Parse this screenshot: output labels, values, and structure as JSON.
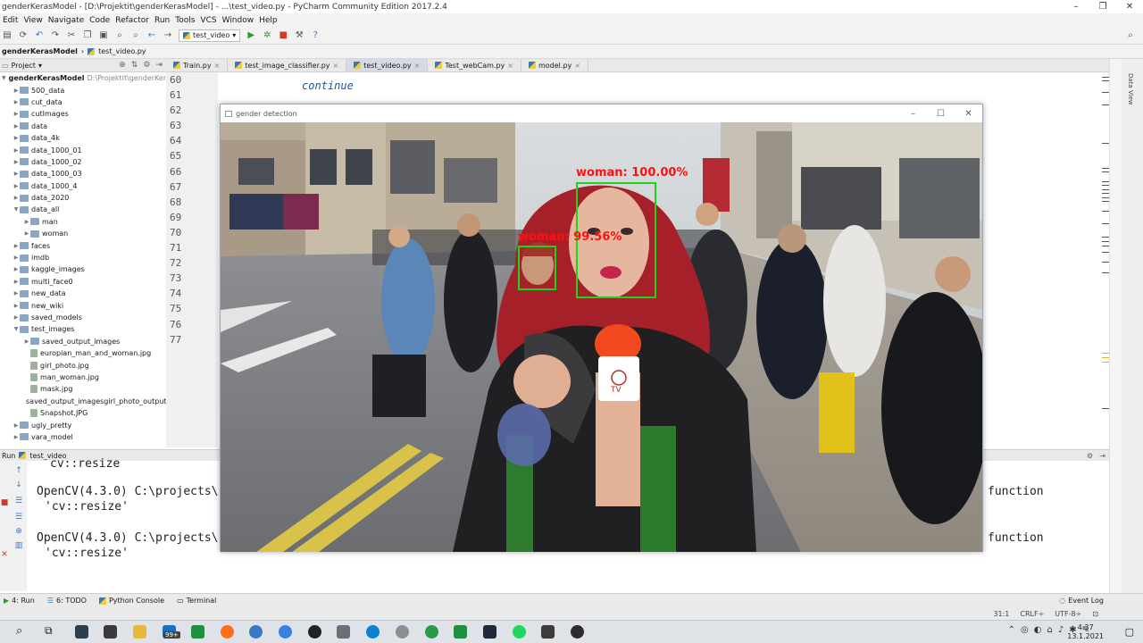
{
  "titlebar": {
    "title": "genderKerasModel - [D:\\Projektit\\genderKerasModel] - ...\\test_video.py - PyCharm Community Edition 2017.2.4",
    "minimize": "–",
    "maximize": "❐",
    "close": "✕"
  },
  "menu": [
    "Edit",
    "View",
    "Navigate",
    "Code",
    "Refactor",
    "Run",
    "Tools",
    "VCS",
    "Window",
    "Help"
  ],
  "toolbar": {
    "run_config": "test_video"
  },
  "navbar": {
    "project": "genderKerasModel",
    "file": "test_video.py"
  },
  "project_panel": {
    "title": "Project",
    "root": {
      "name": "genderKerasModel",
      "path": "D:\\Projektit\\genderKerasModel"
    },
    "items": [
      {
        "label": "500_data",
        "kind": "folder",
        "level": 1,
        "expanded": false
      },
      {
        "label": "cut_data",
        "kind": "folder",
        "level": 1,
        "expanded": false
      },
      {
        "label": "cutImages",
        "kind": "folder",
        "level": 1,
        "expanded": false
      },
      {
        "label": "data",
        "kind": "folder",
        "level": 1,
        "expanded": false
      },
      {
        "label": "data_4k",
        "kind": "folder",
        "level": 1,
        "expanded": false
      },
      {
        "label": "data_1000_01",
        "kind": "folder",
        "level": 1,
        "expanded": false
      },
      {
        "label": "data_1000_02",
        "kind": "folder",
        "level": 1,
        "expanded": false
      },
      {
        "label": "data_1000_03",
        "kind": "folder",
        "level": 1,
        "expanded": false
      },
      {
        "label": "data_1000_4",
        "kind": "folder",
        "level": 1,
        "expanded": false
      },
      {
        "label": "data_2020",
        "kind": "folder",
        "level": 1,
        "expanded": false
      },
      {
        "label": "data_all",
        "kind": "folder",
        "level": 1,
        "expanded": true
      },
      {
        "label": "man",
        "kind": "folder",
        "level": 2,
        "expanded": false
      },
      {
        "label": "woman",
        "kind": "folder",
        "level": 2,
        "expanded": false
      },
      {
        "label": "faces",
        "kind": "folder",
        "level": 1,
        "expanded": false
      },
      {
        "label": "imdb",
        "kind": "folder",
        "level": 1,
        "expanded": false
      },
      {
        "label": "kaggle_images",
        "kind": "folder",
        "level": 1,
        "expanded": false
      },
      {
        "label": "multi_face0",
        "kind": "folder",
        "level": 1,
        "expanded": false
      },
      {
        "label": "new_data",
        "kind": "folder",
        "level": 1,
        "expanded": false
      },
      {
        "label": "new_wiki",
        "kind": "folder",
        "level": 1,
        "expanded": false
      },
      {
        "label": "saved_models",
        "kind": "folder",
        "level": 1,
        "expanded": false
      },
      {
        "label": "test_images",
        "kind": "folder",
        "level": 1,
        "expanded": true
      },
      {
        "label": "saved_output_images",
        "kind": "folder",
        "level": 2,
        "expanded": false
      },
      {
        "label": "europian_man_and_woman.jpg",
        "kind": "file",
        "level": 2
      },
      {
        "label": "girl_photo.jpg",
        "kind": "file",
        "level": 2
      },
      {
        "label": "man_woman.jpg",
        "kind": "file",
        "level": 2
      },
      {
        "label": "mask.jpg",
        "kind": "file",
        "level": 2
      },
      {
        "label": "saved_output_imagesgirl_photo_output",
        "kind": "file",
        "level": 2
      },
      {
        "label": "Snapshot.JPG",
        "kind": "file",
        "level": 2
      },
      {
        "label": "ugly_pretty",
        "kind": "folder",
        "level": 1,
        "expanded": false
      },
      {
        "label": "vara_model",
        "kind": "folder",
        "level": 1,
        "expanded": false
      }
    ]
  },
  "editor": {
    "tabs": [
      {
        "label": "Train.py",
        "active": false
      },
      {
        "label": "test_image_classifier.py",
        "active": false
      },
      {
        "label": "test_video.py",
        "active": true
      },
      {
        "label": "Test_webCam.py",
        "active": false
      },
      {
        "label": "model.py",
        "active": false
      }
    ],
    "line_numbers": [
      "60",
      "61",
      "62",
      "63",
      "64",
      "65",
      "66",
      "67",
      "68",
      "69",
      "70",
      "71",
      "72",
      "73",
      "74",
      "75",
      "76",
      "77"
    ],
    "visible_code": "continue",
    "right_tool_label": "Data View"
  },
  "gd_window": {
    "title": "gender detection",
    "faces": [
      {
        "label": "woman: 100.00%"
      },
      {
        "label": "woman: 99.56%"
      }
    ]
  },
  "run_panel": {
    "tab_label": "Run",
    "config": "test_video",
    "lines": [
      "cv::resize",
      "OpenCV(4.3.0) C:\\projects\\",
      "'cv::resize'",
      "OpenCV(4.3.0) C:\\projects\\",
      "'cv::resize'"
    ],
    "right_text_1": "function",
    "right_text_2": "function"
  },
  "bottom_tools": {
    "run": "4: Run",
    "todo": "6: TODO",
    "python_console": "Python Console",
    "terminal": "Terminal",
    "event_log": "Event Log"
  },
  "status": {
    "position": "31:1",
    "line_sep": "CRLF÷",
    "encoding": "UTF-8÷"
  },
  "taskbar": {
    "badge": "99+",
    "time": "4.37",
    "date": "13.1.2021",
    "colors": {
      "terminal": "#2d3e50",
      "pycharm": "#1f8f3f",
      "firefox": "#ff6d1a",
      "chrome": "#3b7fe4",
      "spotify": "#1ed760",
      "edge": "#0f7fd1"
    }
  }
}
